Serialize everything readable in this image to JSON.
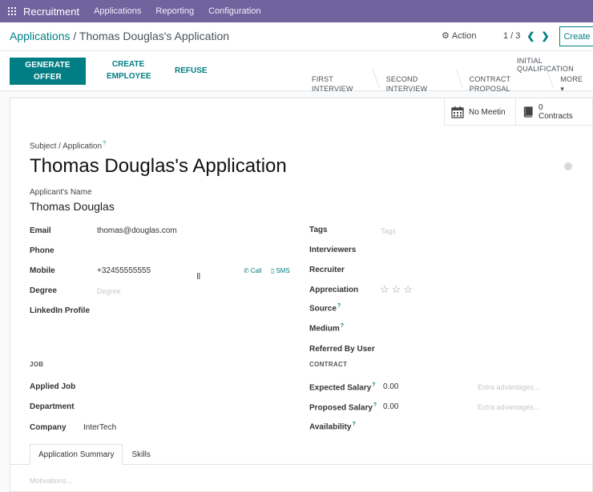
{
  "navbar": {
    "app_name": "Recruitment",
    "menu": [
      "Applications",
      "Reporting",
      "Configuration"
    ]
  },
  "control": {
    "breadcrumb_parent": "Applications",
    "breadcrumb_sep": "/",
    "breadcrumb_current": "Thomas Douglas's Application",
    "action_label": "Action",
    "pager": "1 / 3",
    "create_label": "Create"
  },
  "statusbar": {
    "generate_offer": [
      "GENERATE",
      "OFFER"
    ],
    "create_employee": [
      "CREATE",
      "EMPLOYEE"
    ],
    "refuse": "REFUSE",
    "stage_current": "INITIAL QUALIFICATION",
    "stages": [
      "FIRST INTERVIEW",
      "SECOND INTERVIEW",
      "CONTRACT PROPOSAL"
    ],
    "more_label": "MORE"
  },
  "smart_buttons": {
    "meetings": "No Meetin",
    "contracts_count": "0",
    "contracts_label": "Contracts"
  },
  "form": {
    "subject_label": "Subject / Application",
    "title": "Thomas Douglas's Application",
    "name_label": "Applicant's Name",
    "name_value": "Thomas Douglas",
    "email_label": "Email",
    "email_value": "thomas@douglas.com",
    "phone_label": "Phone",
    "mobile_label": "Mobile",
    "mobile_value": "+32455555555",
    "call_label": "Call",
    "sms_label": "SMS",
    "degree_label": "Degree",
    "degree_placeholder": "Degree",
    "linkedin_label": "LinkedIn Profile",
    "tags_label": "Tags",
    "tags_placeholder": "Tags",
    "interviewers_label": "Interviewers",
    "recruiter_label": "Recruiter",
    "appreciation_label": "Appreciation",
    "source_label": "Source",
    "medium_label": "Medium",
    "referred_label": "Referred By User",
    "job_section": "JOB",
    "applied_job_label": "Applied Job",
    "department_label": "Department",
    "company_label": "Company",
    "company_value": "InterTech",
    "contract_section": "CONTRACT",
    "expected_label": "Expected Salary",
    "expected_value": "0.00",
    "extra_placeholder": "Extra advantages...",
    "proposed_label": "Proposed Salary",
    "proposed_value": "0.00",
    "availability_label": "Availability",
    "tooltip": "?",
    "tab_summary": "Application Summary",
    "tab_skills": "Skills",
    "motivations_placeholder": "Motivations..."
  },
  "colors": {
    "navbar": "#71639e",
    "primary": "#017e84"
  }
}
